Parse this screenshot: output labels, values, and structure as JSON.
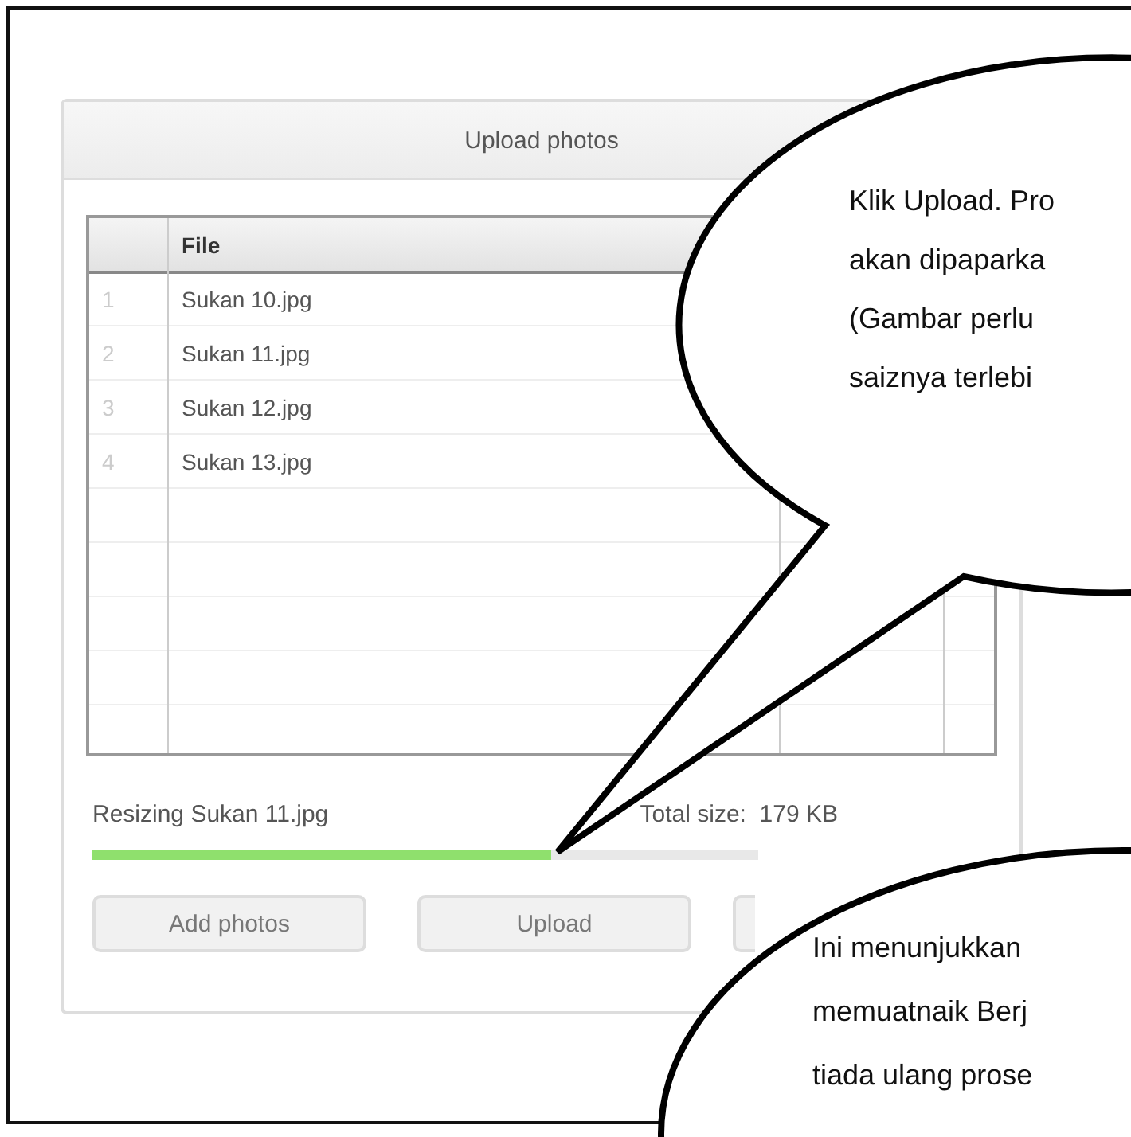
{
  "dialog": {
    "title": "Upload photos",
    "columns": [
      "File"
    ],
    "rows": [
      {
        "number": "1",
        "file": "Sukan 10.jpg"
      },
      {
        "number": "2",
        "file": "Sukan 11.jpg"
      },
      {
        "number": "3",
        "file": "Sukan 12.jpg"
      },
      {
        "number": "4",
        "file": "Sukan 13.jpg"
      }
    ],
    "status": "Resizing Sukan 11.jpg",
    "total_size": "Total size:  179 KB",
    "progress": {
      "level": 0.69
    },
    "buttons": [
      "Add photos",
      "Upload"
    ]
  },
  "callouts": [
    {
      "lines": [
        "Klik Upload. Pro",
        "akan dipaparka",
        "(Gambar perlu",
        "saiznya terlebi"
      ]
    },
    {
      "lines": [
        "Ini menunjukkan",
        "memuatnaik Berj",
        "tiada ulang prose"
      ]
    }
  ]
}
